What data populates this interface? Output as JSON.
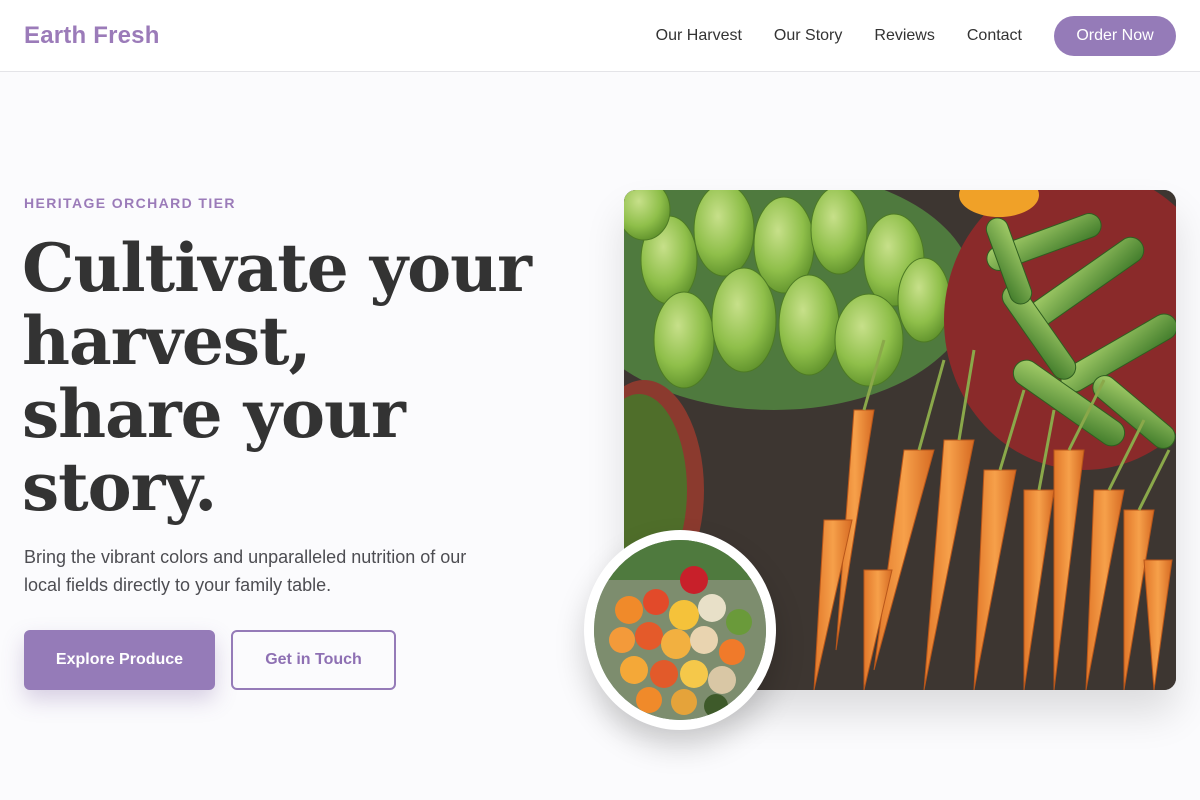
{
  "header": {
    "brand": "Earth Fresh",
    "nav": [
      "Our Harvest",
      "Our Story",
      "Reviews",
      "Contact"
    ],
    "cta": "Order Now"
  },
  "hero": {
    "eyebrow": "HERITAGE ORCHARD TIER",
    "headline_lines": [
      "Cultivate your",
      "harvest,",
      "share your",
      "story."
    ],
    "lede": "Bring the vibrant colors and unparalleled nutrition of our local fields directly to your family table.",
    "primary_button": "Explore Produce",
    "secondary_button": "Get in Touch"
  },
  "colors": {
    "accent": "#957bb8",
    "brand_text": "#9b7bb9",
    "heading": "#333333",
    "background": "#fbfbfd"
  },
  "images": {
    "main": "vegetable-market-photo",
    "inset": "mixed-produce-circle-photo"
  }
}
